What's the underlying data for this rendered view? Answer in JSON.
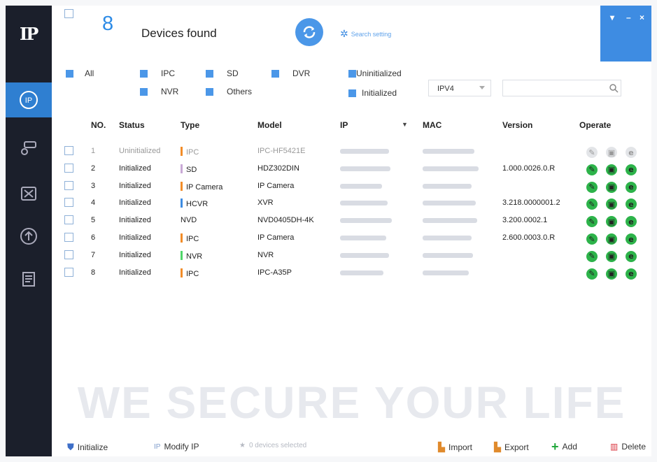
{
  "header": {
    "count": "8",
    "title": "Devices found",
    "search_setting": "Search setting"
  },
  "window": {
    "menu": "▾",
    "minimize": "–",
    "close": "×"
  },
  "filters": {
    "all": "All",
    "ipc": "IPC",
    "sd": "SD",
    "dvr": "DVR",
    "nvr": "NVR",
    "others": "Others",
    "uninitialized": "Uninitialized",
    "initialized": "Initialized"
  },
  "ip_version": {
    "selected": "IPV4"
  },
  "columns": {
    "no": "NO.",
    "status": "Status",
    "type": "Type",
    "model": "Model",
    "ip": "IP",
    "mac": "MAC",
    "version": "Version",
    "operate": "Operate"
  },
  "devices": [
    {
      "no": "1",
      "status": "Uninitialized",
      "type": "IPC",
      "type_color": "#f28c28",
      "model": "IPC-HF5421E",
      "version": "",
      "dim": true
    },
    {
      "no": "2",
      "status": "Initialized",
      "type": "SD",
      "type_color": "#c9a9d6",
      "model": "HDZ302DIN",
      "version": "1.000.0026.0.R",
      "dim": false
    },
    {
      "no": "3",
      "status": "Initialized",
      "type": "IP Camera",
      "type_color": "#f28c28",
      "model": "IP Camera",
      "version": "",
      "dim": false
    },
    {
      "no": "4",
      "status": "Initialized",
      "type": "HCVR",
      "type_color": "#3e8ce2",
      "model": "XVR",
      "version": "3.218.0000001.2",
      "dim": false
    },
    {
      "no": "5",
      "status": "Initialized",
      "type": "NVD",
      "type_color": "",
      "model": "NVD0405DH-4K",
      "version": "3.200.0002.1",
      "dim": false
    },
    {
      "no": "6",
      "status": "Initialized",
      "type": "IPC",
      "type_color": "#f28c28",
      "model": "IP Camera",
      "version": "2.600.0003.0.R",
      "dim": false
    },
    {
      "no": "7",
      "status": "Initialized",
      "type": "NVR",
      "type_color": "#4fd66a",
      "model": "NVR",
      "version": "",
      "dim": false
    },
    {
      "no": "8",
      "status": "Initialized",
      "type": "IPC",
      "type_color": "#f28c28",
      "model": "IPC-A35P",
      "version": "",
      "dim": false
    }
  ],
  "operate_icons": {
    "edit": "✎",
    "web": "▣",
    "ie": "e"
  },
  "footer": {
    "initialize": "Initialize",
    "modify_ip": "Modify IP",
    "selected": "0 devices selected",
    "import": "Import",
    "export": "Export",
    "add": "Add",
    "delete": "Delete"
  },
  "watermark": "WE SECURE YOUR LIFE",
  "colors": {
    "accent": "#2d8be6",
    "sidebar": "#1b1f2b",
    "operate_green": "#2db34a"
  }
}
